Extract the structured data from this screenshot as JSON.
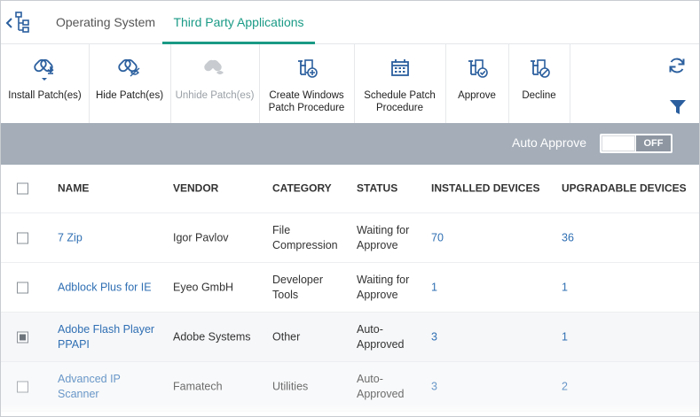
{
  "nav": {
    "back_icon": "tree-back-icon"
  },
  "tabs": [
    {
      "label": "Operating System",
      "active": false
    },
    {
      "label": "Third Party Applications",
      "active": true
    }
  ],
  "toolbar": {
    "buttons": [
      {
        "label": "Install Patch(es)",
        "icon": "install-patch-icon",
        "disabled": false
      },
      {
        "label": "Hide Patch(es)",
        "icon": "hide-patch-icon",
        "disabled": false
      },
      {
        "label": "Unhide Patch(es)",
        "icon": "unhide-patch-icon",
        "disabled": true
      },
      {
        "label_line1": "Create Windows",
        "label_line2": "Patch Procedure",
        "icon": "create-procedure-icon",
        "disabled": false
      },
      {
        "label_line1": "Schedule Patch",
        "label_line2": "Procedure",
        "icon": "calendar-icon",
        "disabled": false
      },
      {
        "label": "Approve",
        "icon": "approve-icon",
        "disabled": false
      },
      {
        "label": "Decline",
        "icon": "decline-icon",
        "disabled": false
      }
    ],
    "refresh_icon": "refresh-icon",
    "filter_icon": "filter-icon"
  },
  "auto_approve": {
    "label": "Auto Approve",
    "state": "OFF"
  },
  "table": {
    "headers": {
      "name": "NAME",
      "vendor": "VENDOR",
      "category": "CATEGORY",
      "status": "STATUS",
      "installed": "INSTALLED DEVICES",
      "upgradable": "UPGRADABLE DEVICES"
    },
    "rows": [
      {
        "checked": false,
        "name_l1": "7 Zip",
        "name_l2": "",
        "vendor": "Igor Pavlov",
        "cat_l1": "File",
        "cat_l2": "Compression",
        "status_l1": "Waiting for",
        "status_l2": "Approve",
        "installed": "70",
        "upgradable": "36"
      },
      {
        "checked": false,
        "name_l1": "Adblock Plus for IE",
        "name_l2": "",
        "vendor": "Eyeo GmbH",
        "cat_l1": "Developer",
        "cat_l2": "Tools",
        "status_l1": "Waiting for",
        "status_l2": "Approve",
        "installed": "1",
        "upgradable": "1"
      },
      {
        "checked": true,
        "name_l1": "Adobe Flash Player",
        "name_l2": "PPAPI",
        "vendor": "Adobe Systems",
        "cat_l1": "Other",
        "cat_l2": "",
        "status_l1": "Auto-",
        "status_l2": "Approved",
        "installed": "3",
        "upgradable": "1"
      },
      {
        "checked": false,
        "name_l1": "Advanced IP",
        "name_l2": "Scanner",
        "vendor": "Famatech",
        "cat_l1": "Utilities",
        "cat_l2": "",
        "status_l1": "Auto-",
        "status_l2": "Approved",
        "installed": "3",
        "upgradable": "2"
      }
    ]
  },
  "colors": {
    "accent": "#1a9a86",
    "link": "#2f6fb3",
    "banner": "#a4adb8",
    "toggle_off": "#8d96a1"
  }
}
